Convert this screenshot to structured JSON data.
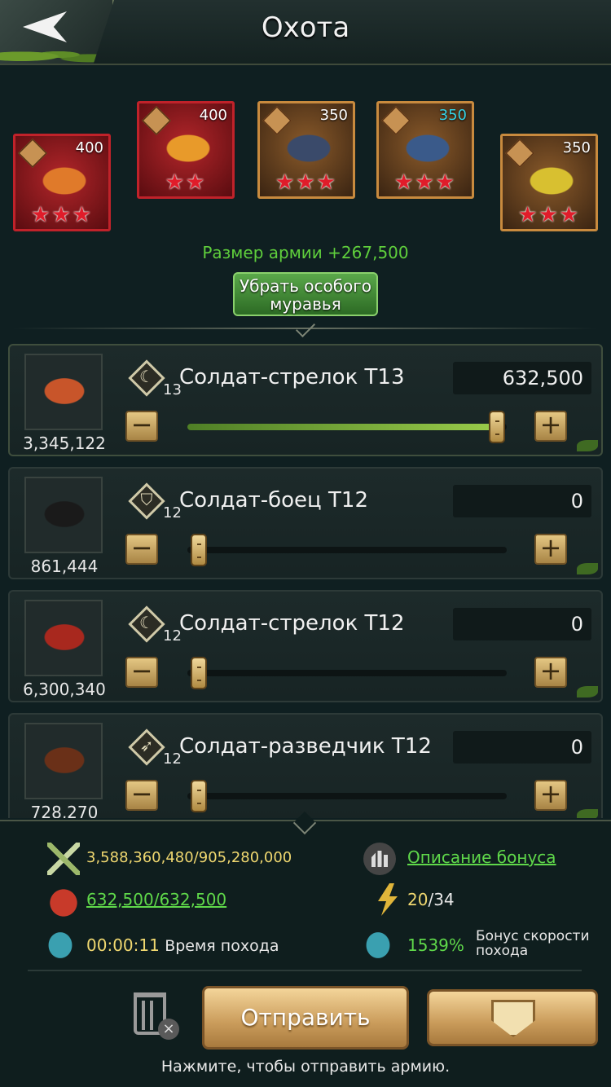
{
  "header": {
    "title": "Охота"
  },
  "heroes": [
    {
      "level": "400",
      "stars": "★★★",
      "frame": "red",
      "level_color": "white",
      "bug_color": "#e07a2a"
    },
    {
      "level": "400",
      "stars": "★★",
      "frame": "red",
      "level_color": "white",
      "bug_color": "#e89a2a"
    },
    {
      "level": "350",
      "stars": "★★★",
      "frame": "gold",
      "level_color": "white",
      "bug_color": "#3a4a6a"
    },
    {
      "level": "350",
      "stars": "★★★",
      "frame": "gold",
      "level_color": "cyan",
      "bug_color": "#3a5a8a"
    },
    {
      "level": "350",
      "stars": "★★★",
      "frame": "gold",
      "level_color": "white",
      "bug_color": "#d8c030"
    }
  ],
  "army_size": "Размер армии +267,500",
  "remove_special_ant": "Убрать особого муравья",
  "troops": [
    {
      "count": "3,345,122",
      "tier": "13",
      "name": "Солдат-стрелок Т13",
      "quantity": "632,500",
      "slider_fraction": 0.98,
      "class_glyph": "☾",
      "bug_color": "#c8552a"
    },
    {
      "count": "861,444",
      "tier": "12",
      "name": "Солдат-боец Т12",
      "quantity": "0",
      "slider_fraction": 0.0,
      "class_glyph": "⛉",
      "bug_color": "#1a1a1a"
    },
    {
      "count": "6,300,340",
      "tier": "12",
      "name": "Солдат-стрелок Т12",
      "quantity": "0",
      "slider_fraction": 0.0,
      "class_glyph": "☾",
      "bug_color": "#a8281e"
    },
    {
      "count": "728,270",
      "tier": "12",
      "name": "Солдат-разведчик Т12",
      "quantity": "0",
      "slider_fraction": 0.0,
      "class_glyph": "➶",
      "bug_color": "#6a3018"
    }
  ],
  "stats": {
    "power": "3,588,360,480/905,280,000",
    "bonus_description": "Описание бонуса",
    "load": "632,500/632,500",
    "energy_current": "20",
    "energy_max": "/34",
    "march_time": "00:00:11",
    "march_time_label": "Время похода",
    "speed_bonus": "1539%",
    "speed_bonus_label": "Бонус скорости похода"
  },
  "send_button": "Отправить",
  "hint": "Нажмите, чтобы отправить армию.",
  "colors": {
    "accent_green": "#5fd84a",
    "gold": "#f0d870",
    "hero_red": "#c0222a",
    "button_gold": "#c99b5a"
  }
}
